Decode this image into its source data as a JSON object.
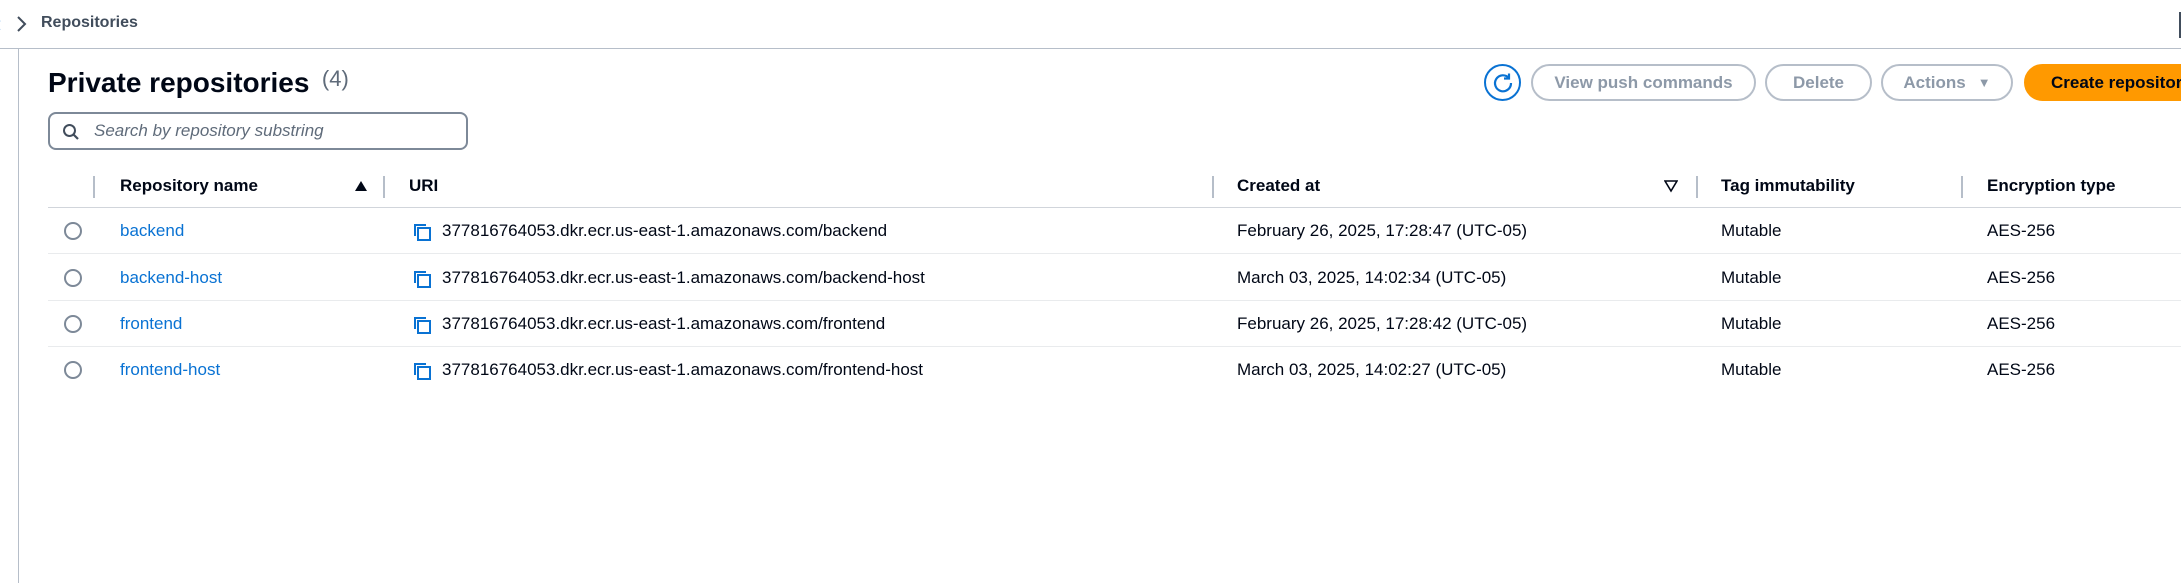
{
  "breadcrumb": {
    "current": "Repositories"
  },
  "header": {
    "title": "Private repositories",
    "count": "(4)"
  },
  "search": {
    "placeholder": "Search by repository substring"
  },
  "toolbar": {
    "view_push": "View push commands",
    "delete": "Delete",
    "actions": "Actions",
    "create": "Create repository"
  },
  "table": {
    "columns": [
      "Repository name",
      "URI",
      "Created at",
      "Tag immutability",
      "Encryption type"
    ],
    "rows": [
      {
        "name": "backend",
        "uri": "377816764053.dkr.ecr.us-east-1.amazonaws.com/backend",
        "created": "February 26, 2025, 17:28:47 (UTC-05)",
        "immutability": "Mutable",
        "encryption": "AES-256"
      },
      {
        "name": "backend-host",
        "uri": "377816764053.dkr.ecr.us-east-1.amazonaws.com/backend-host",
        "created": "March 03, 2025, 14:02:34 (UTC-05)",
        "immutability": "Mutable",
        "encryption": "AES-256"
      },
      {
        "name": "frontend",
        "uri": "377816764053.dkr.ecr.us-east-1.amazonaws.com/frontend",
        "created": "February 26, 2025, 17:28:42 (UTC-05)",
        "immutability": "Mutable",
        "encryption": "AES-256"
      },
      {
        "name": "frontend-host",
        "uri": "377816764053.dkr.ecr.us-east-1.amazonaws.com/frontend-host",
        "created": "March 03, 2025, 14:02:27 (UTC-05)",
        "immutability": "Mutable",
        "encryption": "AES-256"
      }
    ]
  },
  "colors": {
    "link": "#0972d3",
    "primary": "#ff9900",
    "border": "#b6bec9"
  }
}
